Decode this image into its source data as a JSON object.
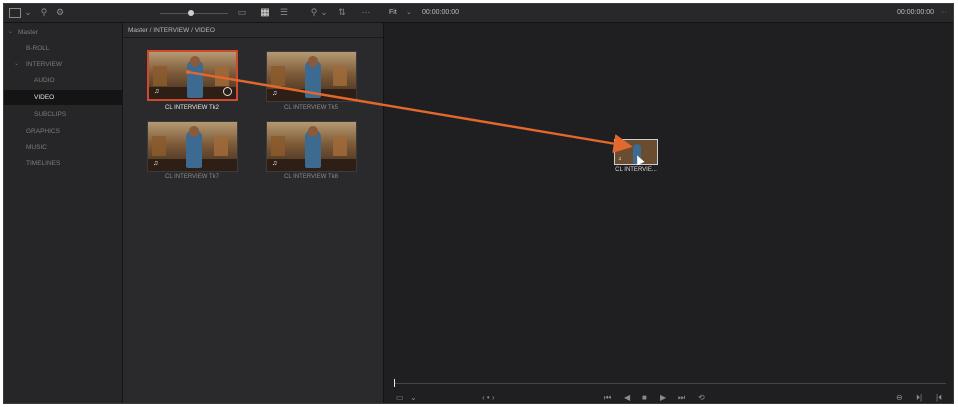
{
  "colors": {
    "accent": "#e2682e",
    "selection": "#d0492f",
    "bg": "#1d1d1f"
  },
  "toolbar": {
    "icons": [
      "panel-layout-icon",
      "chevron-down-icon",
      "metadata-icon",
      "settings-icon",
      "metadata-view-icon",
      "thumbnail-view-icon",
      "list-view-icon",
      "search-icon",
      "chevron-down-icon",
      "sort-icon",
      "more-icon"
    ],
    "fit_label": "Fit",
    "source_timecode": "00:00:00:00",
    "record_timecode": "00:00:00:00"
  },
  "sidebar": {
    "items": [
      {
        "label": "Master",
        "level": 0,
        "selected": false,
        "expanded": true
      },
      {
        "label": "B-ROLL",
        "level": 1,
        "selected": false
      },
      {
        "label": "INTERVIEW",
        "level": 1,
        "selected": false,
        "expanded": true
      },
      {
        "label": "AUDIO",
        "level": 2,
        "selected": false
      },
      {
        "label": "VIDEO",
        "level": 2,
        "selected": true
      },
      {
        "label": "SUBCLIPS",
        "level": 2,
        "selected": false
      },
      {
        "label": "GRAPHICS",
        "level": 1,
        "selected": false
      },
      {
        "label": "MUSIC",
        "level": 1,
        "selected": false
      },
      {
        "label": "TIMELINES",
        "level": 1,
        "selected": false
      }
    ]
  },
  "pool": {
    "path": "Master / INTERVIEW / VIDEO",
    "clips": [
      {
        "name": "CL INTERVIEW Tk2",
        "selected": true
      },
      {
        "name": "CL INTERVIEW Tk5",
        "selected": false
      },
      {
        "name": "CL INTERVIEW Tk7",
        "selected": false
      },
      {
        "name": "CL INTERVIEW Tk8",
        "selected": false
      }
    ]
  },
  "viewer": {
    "drag_clip_label": "CL INTERVIE...",
    "transport": [
      "first-frame-icon",
      "reverse-icon",
      "stop-icon",
      "play-icon",
      "last-frame-icon",
      "loop-icon"
    ]
  }
}
